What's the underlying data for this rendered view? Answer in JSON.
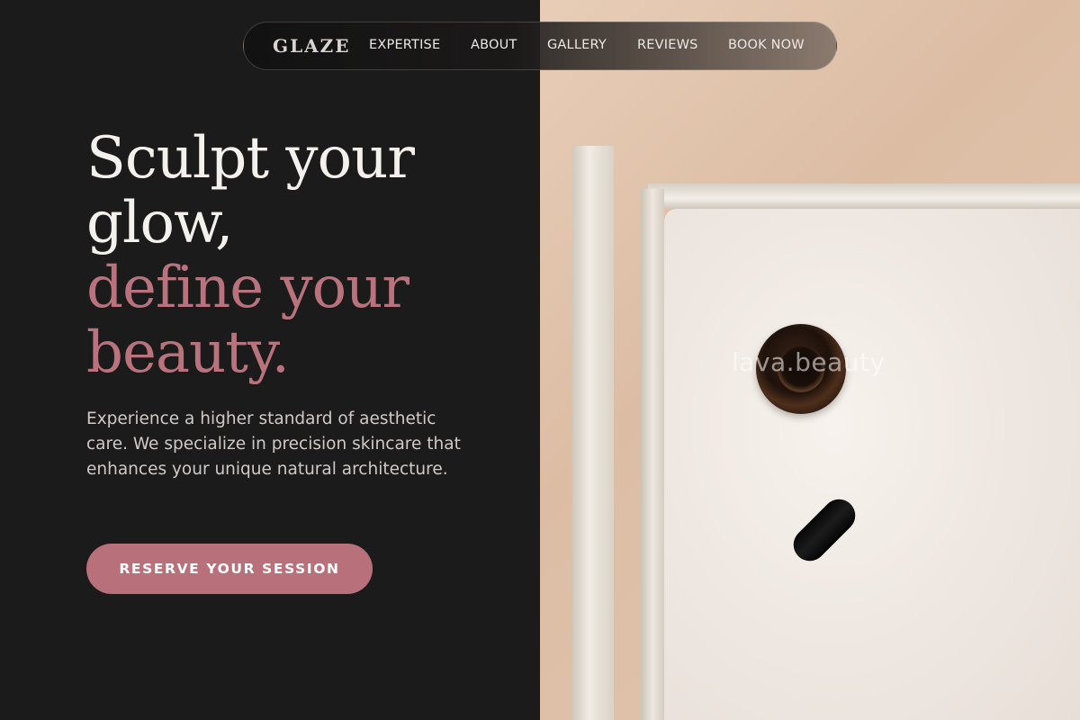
{
  "nav": {
    "brand": "GLAZE",
    "items": [
      {
        "label": "EXPERTISE"
      },
      {
        "label": "ABOUT"
      },
      {
        "label": "GALLERY"
      },
      {
        "label": "REVIEWS"
      },
      {
        "label": "BOOK NOW"
      }
    ]
  },
  "hero": {
    "title_line1": "Sculpt your",
    "title_line2": "glow,",
    "title_line3": "define your",
    "title_line4": "beauty.",
    "subtitle": "Experience a higher standard of aesthetic care. We specialize in precision skincare that enhances your unique natural architecture.",
    "cta_label": "RESERVE YOUR SESSION"
  },
  "image": {
    "watermark": "lava.beauty"
  },
  "colors": {
    "background": "#1c1b1c",
    "accent": "#b9737d",
    "text_primary": "#f4f0ec",
    "text_secondary": "#cfcac6"
  }
}
